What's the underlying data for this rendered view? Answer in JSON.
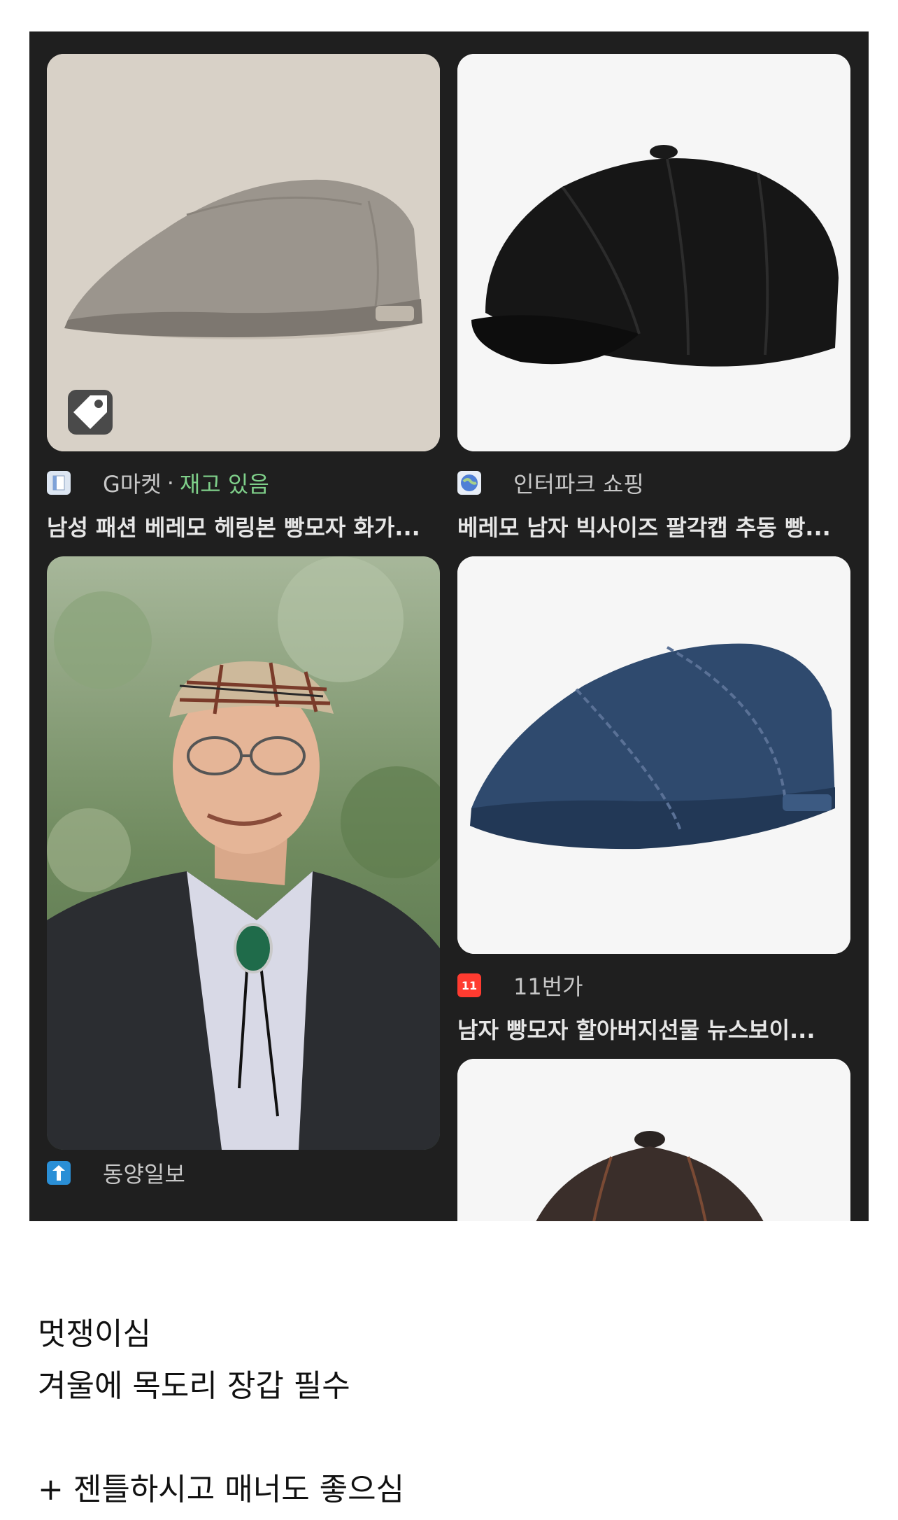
{
  "results": [
    {
      "source": "G마켓",
      "separator": "·",
      "stock": "재고 있음",
      "title": "남성 패션 베레모 헤링본 빵모자 화가...",
      "icon": "gmarket-icon",
      "has_tag": true
    },
    {
      "source": "인터파크 쇼핑",
      "title": "베레모 남자 빅사이즈 팔각캡 추동 빵...",
      "icon": "interpark-icon"
    },
    {
      "source": "동양일보",
      "icon": "dongyang-icon"
    },
    {
      "source": "11번가",
      "icon_label": "11",
      "title": "남자 빵모자 할아버지선물 뉴스보이...",
      "icon": "11st-icon"
    }
  ],
  "caption": {
    "line1": "멋쟁이심",
    "line2": "겨울에 목도리 장갑 필수",
    "line3": "+ 젠틀하시고 매너도 좋으심"
  },
  "colors": {
    "panel": "#1f1f1f",
    "stock_green": "#7fd08a",
    "eleven_red": "#ff3b30"
  }
}
